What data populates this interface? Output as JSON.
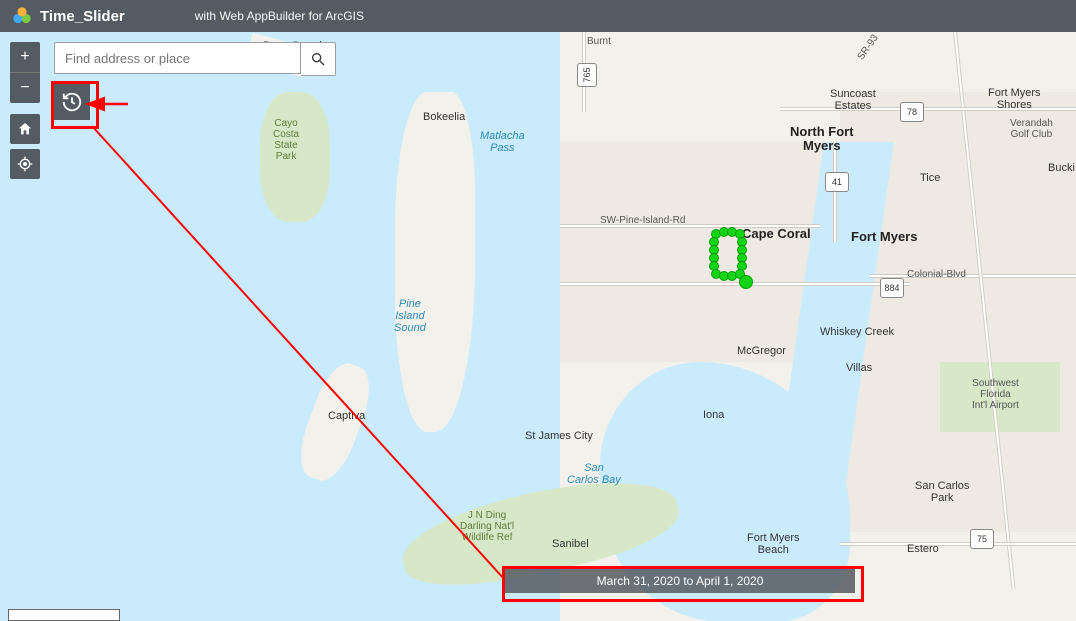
{
  "header": {
    "title": "Time_Slider",
    "subtitle": "with Web AppBuilder for ArcGIS"
  },
  "search": {
    "placeholder": "Find address or place",
    "value": ""
  },
  "controls": {
    "zoom_in_label": "+",
    "zoom_out_label": "−"
  },
  "time_display": "March 31, 2020 to April 1, 2020",
  "map_labels": {
    "boca_grande": "Boca Grande",
    "cayo_costa": "Cayo\nCosta\nState\nPark",
    "bokeelia": "Bokeelia",
    "matlacha": "Matlacha\nPass",
    "pine_island_sound": "Pine\nIsland\nSound",
    "captiva": "Captiva",
    "st_james": "St James City",
    "san_carlos": "San\nCarlos Bay",
    "jn_ding": "J N Ding\nDarling Nat'l\nWildlife Ref",
    "sanibel": "Sanibel",
    "burnt": "Burnt",
    "suncoast": "Suncoast\nEstates",
    "north_fort_myers": "North Fort\nMyers",
    "fort_myers_shores": "Fort Myers\nShores",
    "verandah": "Verandah\nGolf Club",
    "bucki": "Bucki",
    "tice": "Tice",
    "cape_coral": "Cape Coral",
    "fort_myers": "Fort Myers",
    "colonial": "Colonial-Blvd",
    "whiskey_creek": "Whiskey Creek",
    "mcgregor": "McGregor",
    "villas": "Villas",
    "sw_florida_airport": "Southwest\nFlorida\nInt'l Airport",
    "iona": "Iona",
    "san_carlos_park": "San Carlos\nPark",
    "fort_myers_beach": "Fort Myers\nBeach",
    "estero": "Estero",
    "pine_island_rd": "SW-Pine-Island-Rd",
    "r_884": "884",
    "r_41": "41",
    "r_93": "SR-93",
    "r_765": "765",
    "r_78": "78",
    "r_75": "75"
  }
}
